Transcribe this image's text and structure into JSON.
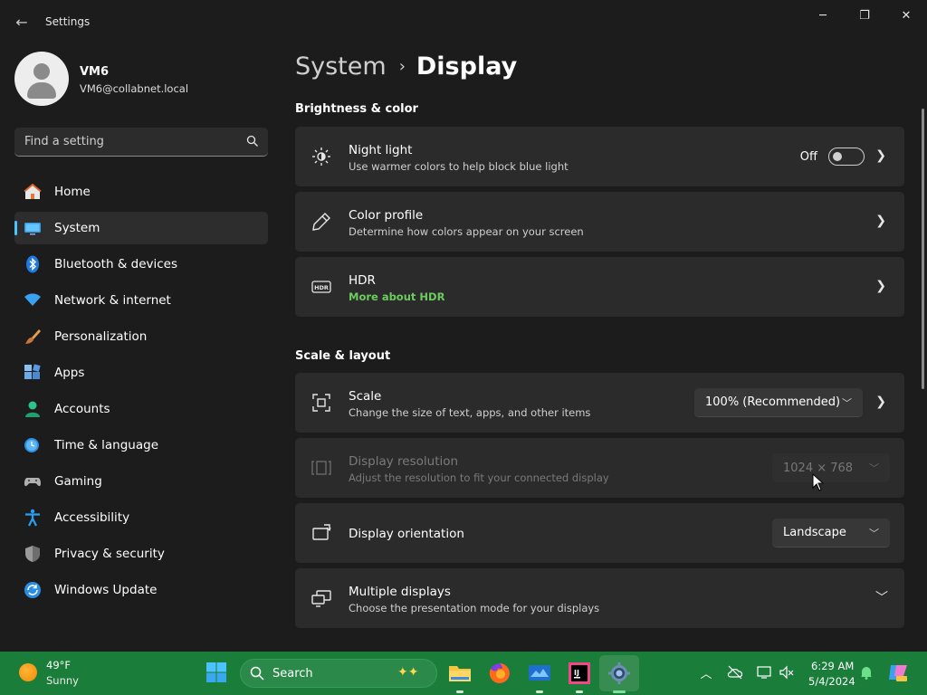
{
  "window": {
    "title": "Settings",
    "minimize": "─",
    "maximize": "❐",
    "close": "✕",
    "back": "←"
  },
  "profile": {
    "name": "VM6",
    "email": "VM6@collabnet.local"
  },
  "search": {
    "placeholder": "Find a setting"
  },
  "sidebar": {
    "items": [
      {
        "label": "Home",
        "icon": "home-icon"
      },
      {
        "label": "System",
        "icon": "system-icon",
        "selected": true
      },
      {
        "label": "Bluetooth & devices",
        "icon": "bluetooth-icon"
      },
      {
        "label": "Network & internet",
        "icon": "network-icon"
      },
      {
        "label": "Personalization",
        "icon": "brush-icon"
      },
      {
        "label": "Apps",
        "icon": "apps-icon"
      },
      {
        "label": "Accounts",
        "icon": "accounts-icon"
      },
      {
        "label": "Time & language",
        "icon": "time-language-icon"
      },
      {
        "label": "Gaming",
        "icon": "gaming-icon"
      },
      {
        "label": "Accessibility",
        "icon": "accessibility-icon"
      },
      {
        "label": "Privacy & security",
        "icon": "shield-icon"
      },
      {
        "label": "Windows Update",
        "icon": "update-icon"
      }
    ]
  },
  "breadcrumb": {
    "parent": "System",
    "separator": "›",
    "current": "Display"
  },
  "sections": {
    "brightness": {
      "title": "Brightness & color",
      "night_light": {
        "title": "Night light",
        "subtitle": "Use warmer colors to help block blue light",
        "toggle_label": "Off",
        "toggle_on": false
      },
      "color_profile": {
        "title": "Color profile",
        "subtitle": "Determine how colors appear on your screen"
      },
      "hdr": {
        "title": "HDR",
        "link": "More about HDR"
      }
    },
    "scale_layout": {
      "title": "Scale & layout",
      "scale": {
        "title": "Scale",
        "subtitle": "Change the size of text, apps, and other items",
        "value": "100% (Recommended)"
      },
      "resolution": {
        "title": "Display resolution",
        "subtitle": "Adjust the resolution to fit your connected display",
        "value": "1024 × 768",
        "disabled": true
      },
      "orientation": {
        "title": "Display orientation",
        "value": "Landscape"
      },
      "multiple": {
        "title": "Multiple displays",
        "subtitle": "Choose the presentation mode for your displays"
      }
    }
  },
  "taskbar": {
    "weather": {
      "temp": "49°F",
      "condition": "Sunny"
    },
    "search_label": "Search",
    "clock": {
      "time": "6:29 AM",
      "date": "5/4/2024"
    }
  },
  "colors": {
    "accent": "#4cc2ff",
    "link": "#6ccb5f",
    "taskbar": "#1b7d3a",
    "background": "#1c1c1c",
    "card": "#2b2b2b"
  }
}
